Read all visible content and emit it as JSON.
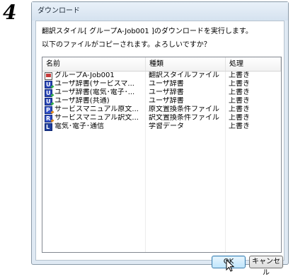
{
  "step_number": "4",
  "dialog": {
    "title": "ダウンロード",
    "message_line1": "翻訳スタイル[ グループA-Job001 ]のダウンロードを実行します。",
    "message_line2": "以下のファイルがコピーされます。よろしいですか？"
  },
  "list": {
    "headers": [
      "名前",
      "種類",
      "処理"
    ],
    "rows": [
      {
        "icon": "job-file-icon",
        "name": "グループA-Job001",
        "type": "翻訳スタイルファイル",
        "action": "上書き"
      },
      {
        "icon": "user-dictionary-icon",
        "name": "ユーザ辞書(サービスマ...",
        "type": "ユーザ辞書",
        "action": "上書き"
      },
      {
        "icon": "user-dictionary-icon",
        "name": "ユーザ辞書(電気･電子･...",
        "type": "ユーザ辞書",
        "action": "上書き"
      },
      {
        "icon": "user-dictionary-icon",
        "name": "ユーザ辞書(共通)",
        "type": "ユーザ辞書",
        "action": "上書き"
      },
      {
        "icon": "source-replace-icon",
        "name": "サービスマニュアル原文...",
        "type": "原文置換条件ファイル",
        "action": "上書き"
      },
      {
        "icon": "translation-replace-icon",
        "name": "サービスマニュアル訳文...",
        "type": "訳文置換条件ファイル",
        "action": "上書き"
      },
      {
        "icon": "learning-data-icon",
        "name": "電気･電子･通信",
        "type": "学習データ",
        "action": "上書き"
      }
    ]
  },
  "buttons": {
    "ok": "OK",
    "cancel": "キャンセル"
  }
}
